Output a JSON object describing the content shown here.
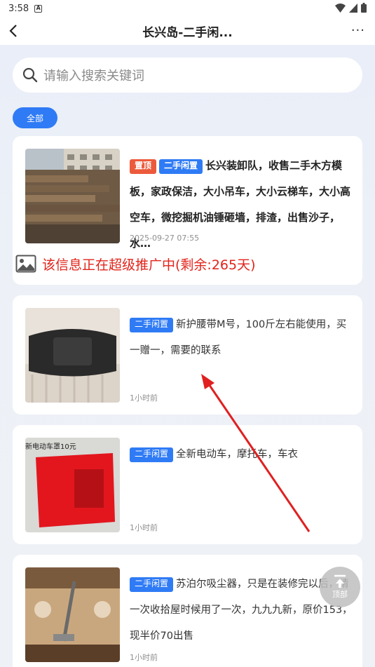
{
  "status_bar": {
    "time": "3:58",
    "app_badge": "A"
  },
  "nav": {
    "title": "长兴岛-二手闲...",
    "more": "···"
  },
  "search": {
    "placeholder": "请输入搜索关键词"
  },
  "filter_chip": {
    "label": "全部"
  },
  "listings": [
    {
      "tags": [
        "置顶",
        "二手闲置"
      ],
      "text": "长兴装卸队，收售二手木方模板，家政保洁，大小吊车，大小云梯车，大小高空车，微挖掘机油锤砸墙，排渣，出售沙子，水…",
      "time": "2025-09-27 07:55",
      "promo": "该信息正在超级推广中(剩余:265天)"
    },
    {
      "tags": [
        "二手闲置"
      ],
      "text": "新护腰带M号，100斤左右能使用，买一赠一，需要的联系",
      "time": "1小时前"
    },
    {
      "tags": [
        "二手闲置"
      ],
      "text": "全新电动车，摩托车，车衣",
      "time": "1小时前",
      "thumb_caption": "新电动车罩10元"
    },
    {
      "tags": [
        "二手闲置"
      ],
      "text": "苏泊尔吸尘器，只是在装修完以后，请一次收拾屋时候用了一次，九九九新，原价153，现半价70出售",
      "time": "1小时前"
    }
  ],
  "back_to_top": {
    "label": "顶部"
  },
  "colors": {
    "accent_blue": "#2f7bf5",
    "tag_red": "#ec5a3c",
    "promo_red": "#e2231a",
    "annotation_arrow": "#e02020"
  }
}
